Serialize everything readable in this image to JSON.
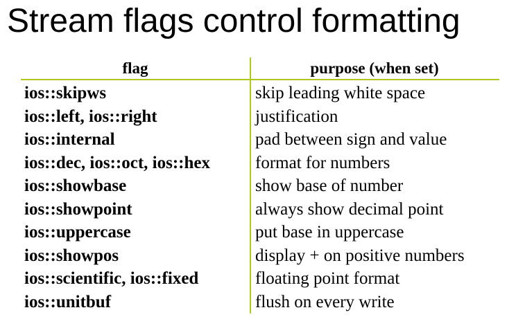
{
  "title": "Stream flags control formatting",
  "table": {
    "headers": {
      "flag": "flag",
      "purpose": "purpose (when set)"
    },
    "rows": [
      {
        "flag": "ios::skipws",
        "purpose": "skip leading white space"
      },
      {
        "flag": "ios::left, ios::right",
        "purpose": "justification"
      },
      {
        "flag": "ios::internal",
        "purpose": "pad between sign and value"
      },
      {
        "flag": "ios::dec, ios::oct, ios::hex",
        "purpose": "format for numbers"
      },
      {
        "flag": "ios::showbase",
        "purpose": "show base of number"
      },
      {
        "flag": "ios::showpoint",
        "purpose": "always show decimal point"
      },
      {
        "flag": "ios::uppercase",
        "purpose": "put base in uppercase"
      },
      {
        "flag": "ios::showpos",
        "purpose": "display + on positive numbers"
      },
      {
        "flag": "ios::scientific, ios::fixed",
        "purpose": "floating point format"
      },
      {
        "flag": "ios::unitbuf",
        "purpose": "flush on every write"
      }
    ]
  },
  "colors": {
    "rule": "#b2c71e",
    "text": "#000000",
    "background": "#ffffff"
  }
}
